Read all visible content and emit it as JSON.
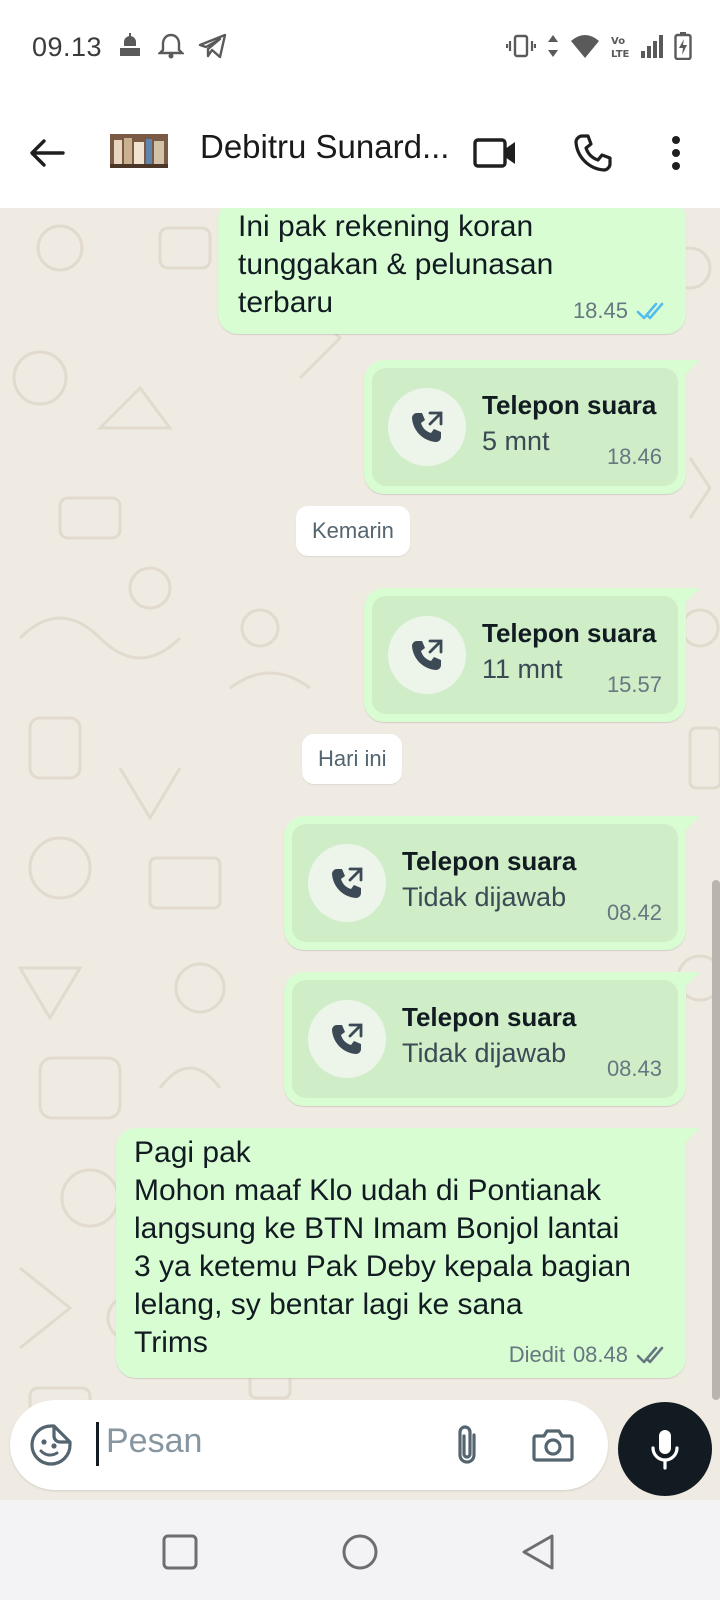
{
  "status_bar": {
    "time": "09.13",
    "icons": [
      "mosque-icon",
      "bell-icon",
      "telegram-icon",
      "vibrate-icon",
      "data-arrows-icon",
      "wifi-icon",
      "volte-icon",
      "signal-icon",
      "battery-charging-icon"
    ]
  },
  "header": {
    "contact_name": "Debitru Sunard...",
    "icons": [
      "back-arrow-icon",
      "video-call-icon",
      "phone-icon",
      "more-vertical-icon"
    ]
  },
  "messages": [
    {
      "type": "text",
      "text": "Ini pak rekening koran\ntunggakan & pelunasan\nterbaru",
      "time": "18.45",
      "status": "read"
    },
    {
      "type": "call",
      "title": "Telepon suara",
      "subtitle": "5 mnt",
      "time": "18.46"
    },
    {
      "type": "date",
      "label": "Kemarin"
    },
    {
      "type": "call",
      "title": "Telepon suara",
      "subtitle": "11 mnt",
      "time": "15.57"
    },
    {
      "type": "date",
      "label": "Hari ini"
    },
    {
      "type": "call",
      "title": "Telepon suara",
      "subtitle": "Tidak dijawab",
      "time": "08.42"
    },
    {
      "type": "call",
      "title": "Telepon suara",
      "subtitle": "Tidak dijawab",
      "time": "08.43"
    },
    {
      "type": "text",
      "text": "Pagi pak\nMohon maaf Klo udah di Pontianak\nlangsung ke BTN Imam Bonjol lantai\n3 ya ketemu Pak Deby kepala bagian\nlelang, sy bentar lagi ke sana\nTrims",
      "edited": "Diedit",
      "time": "08.48",
      "status": "delivered"
    }
  ],
  "composer": {
    "placeholder": "Pesan",
    "icons": [
      "sticker-icon",
      "paperclip-icon",
      "camera-icon",
      "microphone-icon"
    ]
  },
  "colors": {
    "outgoing_bubble": "#d9fdd3",
    "read_tick": "#53bdeb",
    "chat_background": "#efeae2"
  }
}
